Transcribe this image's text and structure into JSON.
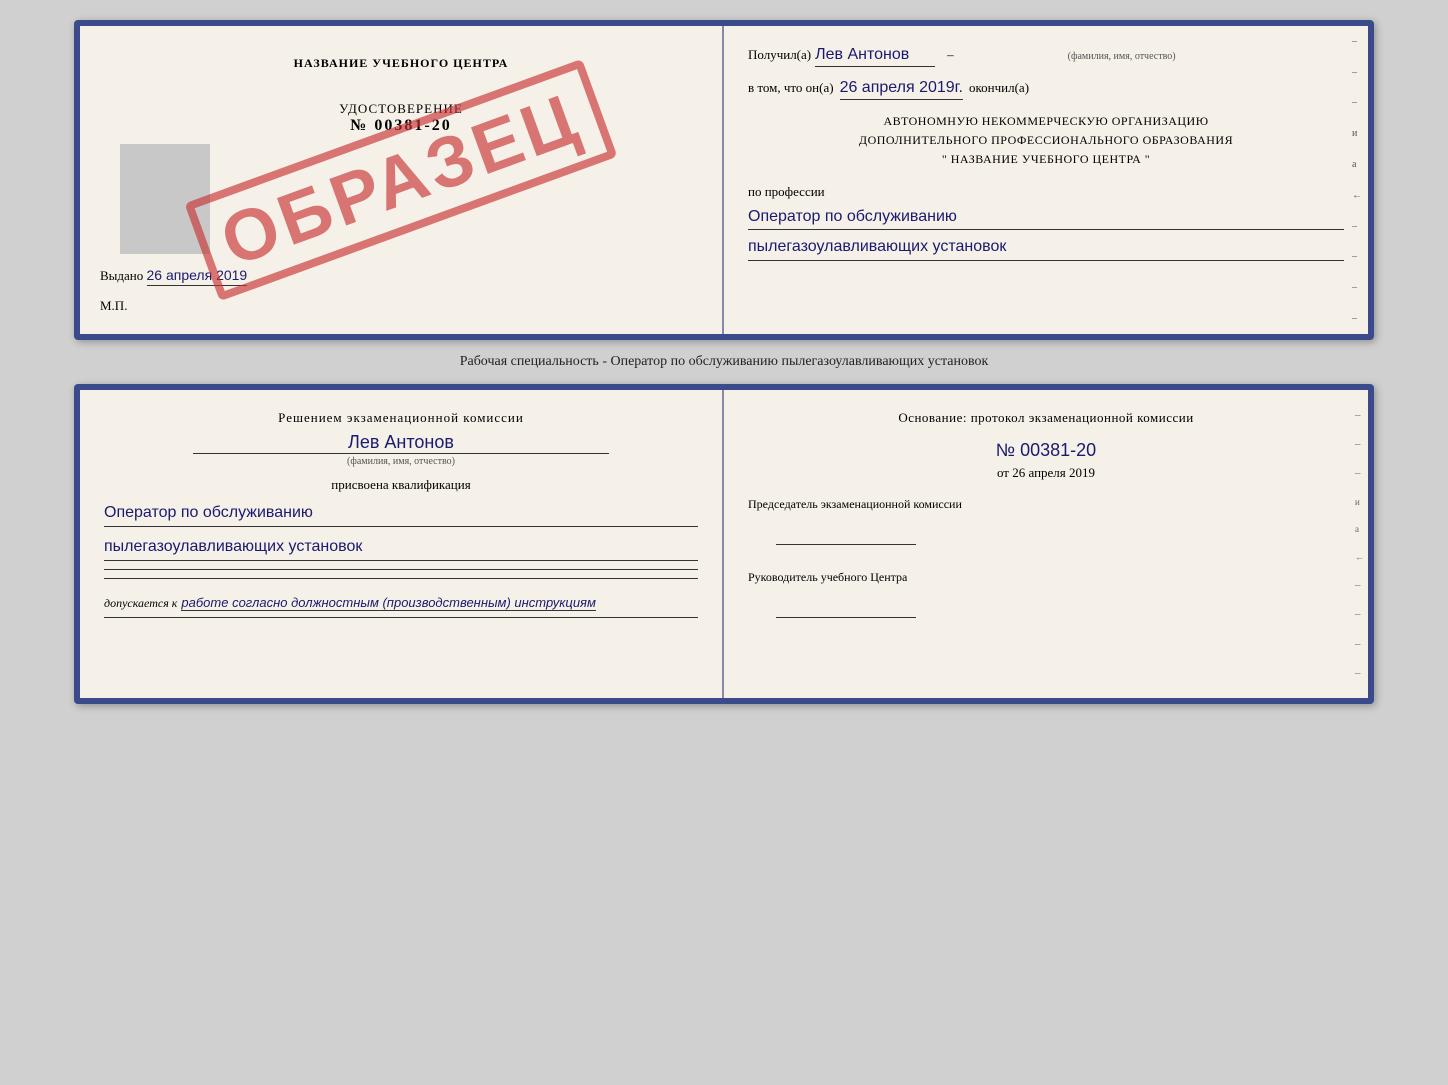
{
  "cert": {
    "title": "НАЗВАНИЕ УЧЕБНОГО ЦЕНТРА",
    "watermark": "ОБРАЗЕЦ",
    "cert_label": "УДОСТОВЕРЕНИЕ",
    "cert_number": "№ 00381-20",
    "issued_prefix": "Выдано",
    "issued_date": "26 апреля 2019",
    "mp_label": "М.П.",
    "received_prefix": "Получил(а)",
    "recipient_name": "Лев Антонов",
    "fio_hint": "(фамилия, имя, отчество)",
    "date_prefix": "в том, что он(а)",
    "completion_date": "26 апреля 2019г.",
    "completed_suffix": "окончил(а)",
    "org_line1": "АВТОНОМНУЮ НЕКОММЕРЧЕСКУЮ ОРГАНИЗАЦИЮ",
    "org_line2": "ДОПОЛНИТЕЛЬНОГО ПРОФЕССИОНАЛЬНОГО ОБРАЗОВАНИЯ",
    "org_line3": "\"    НАЗВАНИЕ УЧЕБНОГО ЦЕНТРА    \"",
    "profession_prefix": "по профессии",
    "profession_line1": "Оператор по обслуживанию",
    "profession_line2": "пылегазоулавливающих установок"
  },
  "middle_label": "Рабочая специальность - Оператор по обслуживанию пылегазоулавливающих установок",
  "qual": {
    "decision_text": "Решением экзаменационной комиссии",
    "name": "Лев Антонов",
    "fio_hint": "(фамилия, имя, отчество)",
    "assigned_text": "присвоена квалификация",
    "qual_line1": "Оператор по обслуживанию",
    "qual_line2": "пылегазоулавливающих установок",
    "admitted_prefix": "допускается к",
    "admitted_text": "работе согласно должностным (производственным) инструкциям",
    "basis_text": "Основание: протокол экзаменационной комиссии",
    "protocol_number": "№ 00381-20",
    "from_prefix": "от",
    "from_date": "26 апреля 2019",
    "chairman_label": "Председатель экзаменационной комиссии",
    "director_label": "Руководитель учебного Центра"
  },
  "right_marks": [
    "и",
    "а",
    "←",
    "–",
    "–",
    "–",
    "–"
  ],
  "right_marks2": [
    "–",
    "–",
    "–",
    "и",
    "а",
    "←",
    "–",
    "–",
    "–",
    "–"
  ]
}
